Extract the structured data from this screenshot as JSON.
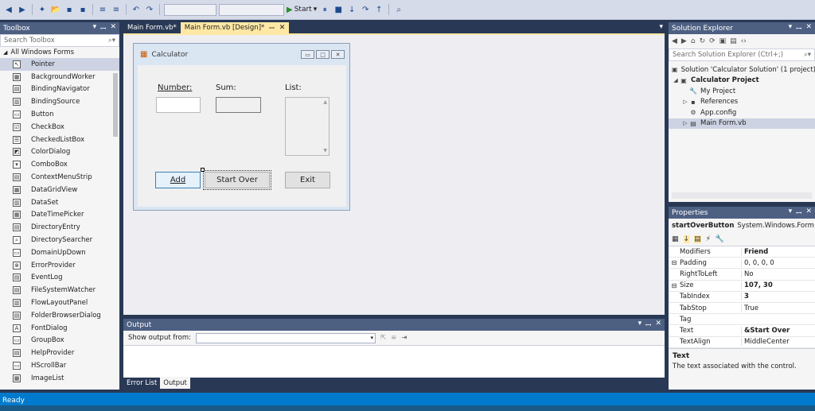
{
  "toolbar": {
    "start_label": "Start",
    "dropdown_arrow": "▾"
  },
  "toolbox": {
    "title": "Toolbox",
    "search_placeholder": "Search Toolbox",
    "group": "All Windows Forms",
    "items": [
      "Pointer",
      "BackgroundWorker",
      "BindingNavigator",
      "BindingSource",
      "Button",
      "CheckBox",
      "CheckedListBox",
      "ColorDialog",
      "ComboBox",
      "ContextMenuStrip",
      "DataGridView",
      "DataSet",
      "DateTimePicker",
      "DirectoryEntry",
      "DirectorySearcher",
      "DomainUpDown",
      "ErrorProvider",
      "EventLog",
      "FileSystemWatcher",
      "FlowLayoutPanel",
      "FolderBrowserDialog",
      "FontDialog",
      "GroupBox",
      "HelpProvider",
      "HScrollBar",
      "ImageList"
    ],
    "icons": [
      "↖",
      "▦",
      "▤",
      "▥",
      "▭",
      "☑",
      "☰",
      "◩",
      "▾",
      "▤",
      "▦",
      "▥",
      "▦",
      "▤",
      "⌕",
      "▭",
      "⊗",
      "▤",
      "▤",
      "▥",
      "▤",
      "A",
      "▭",
      "▤",
      "▭",
      "▦"
    ]
  },
  "doc_tabs": [
    {
      "label": "Main Form.vb*",
      "active": false
    },
    {
      "label": "Main Form.vb [Design]*",
      "active": true
    }
  ],
  "form": {
    "title": "Calculator",
    "number_label": "Number:",
    "sum_label": "Sum:",
    "list_label": "List:",
    "add_label": "Add",
    "start_over_label": "Start Over",
    "exit_label": "Exit"
  },
  "output": {
    "title": "Output",
    "show_output_from": "Show output from:",
    "tabs": [
      {
        "label": "Error List",
        "active": false
      },
      {
        "label": "Output",
        "active": true
      }
    ]
  },
  "solution_explorer": {
    "title": "Solution Explorer",
    "search_placeholder": "Search Solution Explorer (Ctrl+;)",
    "tree": [
      {
        "label": "Solution 'Calculator Solution' (1 project)",
        "level": 0,
        "expander": "",
        "icon": "▣",
        "bold": false,
        "selected": false
      },
      {
        "label": "Calculator Project",
        "level": 0,
        "expander": "◢",
        "icon": "▣",
        "bold": true,
        "selected": false
      },
      {
        "label": "My Project",
        "level": 1,
        "expander": "",
        "icon": "🔧",
        "bold": false,
        "selected": false
      },
      {
        "label": "References",
        "level": 1,
        "expander": "▷",
        "icon": "▪",
        "bold": false,
        "selected": false
      },
      {
        "label": "App.config",
        "level": 1,
        "expander": "",
        "icon": "⚙",
        "bold": false,
        "selected": false
      },
      {
        "label": "Main Form.vb",
        "level": 1,
        "expander": "▷",
        "icon": "▤",
        "bold": false,
        "selected": true
      }
    ]
  },
  "properties": {
    "title": "Properties",
    "object_name": "startOverButton",
    "object_type": "System.Windows.Form",
    "rows": [
      {
        "name": "Modifiers",
        "value": "Friend",
        "expander": "",
        "bold": true
      },
      {
        "name": "Padding",
        "value": "0, 0, 0, 0",
        "expander": "⊟",
        "bold": false
      },
      {
        "name": "RightToLeft",
        "value": "No",
        "expander": "",
        "bold": false
      },
      {
        "name": "Size",
        "value": "107, 30",
        "expander": "⊟",
        "bold": true
      },
      {
        "name": "TabIndex",
        "value": "3",
        "expander": "",
        "bold": true
      },
      {
        "name": "TabStop",
        "value": "True",
        "expander": "",
        "bold": false
      },
      {
        "name": "Tag",
        "value": "",
        "expander": "",
        "bold": false
      },
      {
        "name": "Text",
        "value": "&Start Over",
        "expander": "",
        "bold": true
      },
      {
        "name": "TextAlign",
        "value": "MiddleCenter",
        "expander": "",
        "bold": false
      }
    ],
    "desc_title": "Text",
    "desc_text": "The text associated with the control."
  },
  "status": {
    "text": "Ready"
  },
  "colors": {
    "chrome": "#293955",
    "accent_tab": "#ffe8a6",
    "status_bar": "#007acc"
  }
}
